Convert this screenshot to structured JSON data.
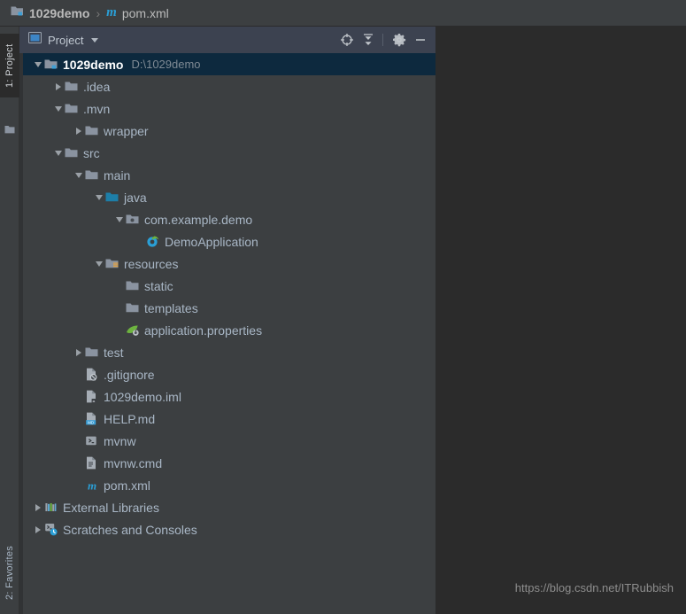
{
  "breadcrumb": {
    "project_name": "1029demo",
    "separator": "›",
    "file_name": "pom.xml",
    "file_icon": "maven-m-icon",
    "project_icon": "module-folder-icon"
  },
  "toolstrip": {
    "project_tab": "1: Project",
    "favorites_tab": "2: Favorites",
    "folder_icon": "folder-icon"
  },
  "panel": {
    "title": "Project",
    "title_icon": "project-view-icon",
    "dropdown_icon": "chevron-down-icon",
    "actions": [
      {
        "name": "locate-in-tree-icon",
        "label": "Select Opened File"
      },
      {
        "name": "collapse-all-icon",
        "label": "Collapse All"
      },
      {
        "name": "gear-icon",
        "label": "Settings"
      },
      {
        "name": "minimize-icon",
        "label": "Hide"
      }
    ]
  },
  "tree": {
    "items": [
      {
        "label": "1029demo",
        "sub": "D:\\1029demo",
        "indent": 0,
        "arrow": "down",
        "icon": "module-folder-icon",
        "selected": true
      },
      {
        "label": ".idea",
        "sub": "",
        "indent": 1,
        "arrow": "right",
        "icon": "folder-icon",
        "selected": false
      },
      {
        "label": ".mvn",
        "sub": "",
        "indent": 1,
        "arrow": "down",
        "icon": "folder-icon",
        "selected": false
      },
      {
        "label": "wrapper",
        "sub": "",
        "indent": 2,
        "arrow": "right",
        "icon": "folder-icon",
        "selected": false
      },
      {
        "label": "src",
        "sub": "",
        "indent": 1,
        "arrow": "down",
        "icon": "folder-icon",
        "selected": false
      },
      {
        "label": "main",
        "sub": "",
        "indent": 2,
        "arrow": "down",
        "icon": "folder-icon",
        "selected": false
      },
      {
        "label": "java",
        "sub": "",
        "indent": 3,
        "arrow": "down",
        "icon": "source-root-folder-icon",
        "selected": false
      },
      {
        "label": "com.example.demo",
        "sub": "",
        "indent": 4,
        "arrow": "down",
        "icon": "package-icon",
        "selected": false
      },
      {
        "label": "DemoApplication",
        "sub": "",
        "indent": 5,
        "arrow": "none",
        "icon": "spring-boot-class-icon",
        "selected": false
      },
      {
        "label": "resources",
        "sub": "",
        "indent": 3,
        "arrow": "down",
        "icon": "resource-root-folder-icon",
        "selected": false
      },
      {
        "label": "static",
        "sub": "",
        "indent": 4,
        "arrow": "none",
        "icon": "folder-icon",
        "selected": false
      },
      {
        "label": "templates",
        "sub": "",
        "indent": 4,
        "arrow": "none",
        "icon": "folder-icon",
        "selected": false
      },
      {
        "label": "application.properties",
        "sub": "",
        "indent": 4,
        "arrow": "none",
        "icon": "spring-properties-icon",
        "selected": false
      },
      {
        "label": "test",
        "sub": "",
        "indent": 2,
        "arrow": "right",
        "icon": "folder-icon",
        "selected": false
      },
      {
        "label": ".gitignore",
        "sub": "",
        "indent": 2,
        "arrow": "none",
        "icon": "gitignore-file-icon",
        "selected": false
      },
      {
        "label": "1029demo.iml",
        "sub": "",
        "indent": 2,
        "arrow": "none",
        "icon": "iml-file-icon",
        "selected": false
      },
      {
        "label": "HELP.md",
        "sub": "",
        "indent": 2,
        "arrow": "none",
        "icon": "markdown-file-icon",
        "selected": false
      },
      {
        "label": "mvnw",
        "sub": "",
        "indent": 2,
        "arrow": "none",
        "icon": "shell-script-icon",
        "selected": false
      },
      {
        "label": "mvnw.cmd",
        "sub": "",
        "indent": 2,
        "arrow": "none",
        "icon": "cmd-script-icon",
        "selected": false
      },
      {
        "label": "pom.xml",
        "sub": "",
        "indent": 2,
        "arrow": "none",
        "icon": "maven-m-icon",
        "selected": false
      },
      {
        "label": "External Libraries",
        "sub": "",
        "indent": 0,
        "arrow": "right",
        "icon": "libraries-icon",
        "selected": false
      },
      {
        "label": "Scratches and Consoles",
        "sub": "",
        "indent": 0,
        "arrow": "right",
        "icon": "scratches-icon",
        "selected": false
      }
    ]
  },
  "watermark": "https://blog.csdn.net/ITRubbish",
  "colors": {
    "panel_bg": "#3c3f41",
    "editor_bg": "#2b2b2b",
    "header_bg": "#3c4250",
    "selection_bg": "#0d293e",
    "text": "#a9b7c6",
    "muted_text": "#7f8a94",
    "accent_blue": "#3d85c6",
    "folder_gray": "#8a93a0",
    "source_blue": "#1d7ea8",
    "resource_orange": "#e8a33d",
    "spring_green": "#6db33f"
  }
}
